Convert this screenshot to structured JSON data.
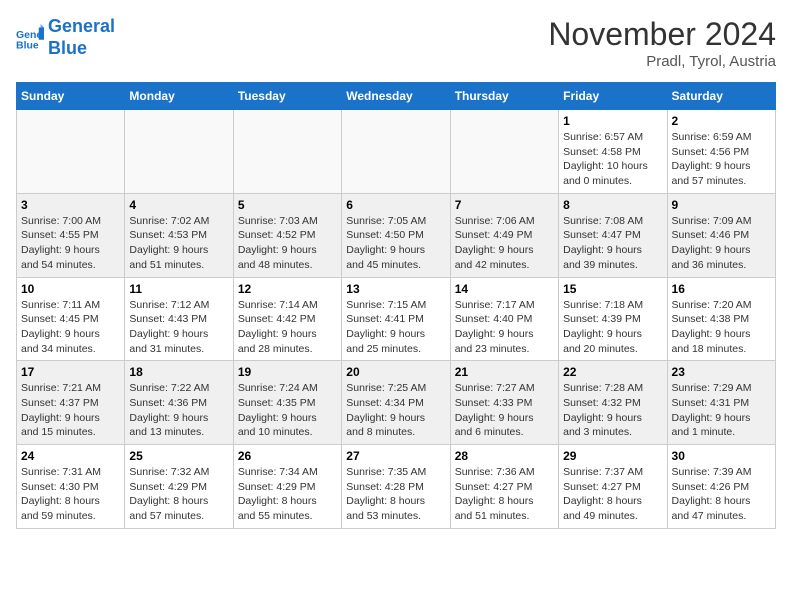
{
  "header": {
    "logo_line1": "General",
    "logo_line2": "Blue",
    "month": "November 2024",
    "location": "Pradl, Tyrol, Austria"
  },
  "weekdays": [
    "Sunday",
    "Monday",
    "Tuesday",
    "Wednesday",
    "Thursday",
    "Friday",
    "Saturday"
  ],
  "weeks": [
    [
      {
        "day": "",
        "info": ""
      },
      {
        "day": "",
        "info": ""
      },
      {
        "day": "",
        "info": ""
      },
      {
        "day": "",
        "info": ""
      },
      {
        "day": "",
        "info": ""
      },
      {
        "day": "1",
        "info": "Sunrise: 6:57 AM\nSunset: 4:58 PM\nDaylight: 10 hours\nand 0 minutes."
      },
      {
        "day": "2",
        "info": "Sunrise: 6:59 AM\nSunset: 4:56 PM\nDaylight: 9 hours\nand 57 minutes."
      }
    ],
    [
      {
        "day": "3",
        "info": "Sunrise: 7:00 AM\nSunset: 4:55 PM\nDaylight: 9 hours\nand 54 minutes."
      },
      {
        "day": "4",
        "info": "Sunrise: 7:02 AM\nSunset: 4:53 PM\nDaylight: 9 hours\nand 51 minutes."
      },
      {
        "day": "5",
        "info": "Sunrise: 7:03 AM\nSunset: 4:52 PM\nDaylight: 9 hours\nand 48 minutes."
      },
      {
        "day": "6",
        "info": "Sunrise: 7:05 AM\nSunset: 4:50 PM\nDaylight: 9 hours\nand 45 minutes."
      },
      {
        "day": "7",
        "info": "Sunrise: 7:06 AM\nSunset: 4:49 PM\nDaylight: 9 hours\nand 42 minutes."
      },
      {
        "day": "8",
        "info": "Sunrise: 7:08 AM\nSunset: 4:47 PM\nDaylight: 9 hours\nand 39 minutes."
      },
      {
        "day": "9",
        "info": "Sunrise: 7:09 AM\nSunset: 4:46 PM\nDaylight: 9 hours\nand 36 minutes."
      }
    ],
    [
      {
        "day": "10",
        "info": "Sunrise: 7:11 AM\nSunset: 4:45 PM\nDaylight: 9 hours\nand 34 minutes."
      },
      {
        "day": "11",
        "info": "Sunrise: 7:12 AM\nSunset: 4:43 PM\nDaylight: 9 hours\nand 31 minutes."
      },
      {
        "day": "12",
        "info": "Sunrise: 7:14 AM\nSunset: 4:42 PM\nDaylight: 9 hours\nand 28 minutes."
      },
      {
        "day": "13",
        "info": "Sunrise: 7:15 AM\nSunset: 4:41 PM\nDaylight: 9 hours\nand 25 minutes."
      },
      {
        "day": "14",
        "info": "Sunrise: 7:17 AM\nSunset: 4:40 PM\nDaylight: 9 hours\nand 23 minutes."
      },
      {
        "day": "15",
        "info": "Sunrise: 7:18 AM\nSunset: 4:39 PM\nDaylight: 9 hours\nand 20 minutes."
      },
      {
        "day": "16",
        "info": "Sunrise: 7:20 AM\nSunset: 4:38 PM\nDaylight: 9 hours\nand 18 minutes."
      }
    ],
    [
      {
        "day": "17",
        "info": "Sunrise: 7:21 AM\nSunset: 4:37 PM\nDaylight: 9 hours\nand 15 minutes."
      },
      {
        "day": "18",
        "info": "Sunrise: 7:22 AM\nSunset: 4:36 PM\nDaylight: 9 hours\nand 13 minutes."
      },
      {
        "day": "19",
        "info": "Sunrise: 7:24 AM\nSunset: 4:35 PM\nDaylight: 9 hours\nand 10 minutes."
      },
      {
        "day": "20",
        "info": "Sunrise: 7:25 AM\nSunset: 4:34 PM\nDaylight: 9 hours\nand 8 minutes."
      },
      {
        "day": "21",
        "info": "Sunrise: 7:27 AM\nSunset: 4:33 PM\nDaylight: 9 hours\nand 6 minutes."
      },
      {
        "day": "22",
        "info": "Sunrise: 7:28 AM\nSunset: 4:32 PM\nDaylight: 9 hours\nand 3 minutes."
      },
      {
        "day": "23",
        "info": "Sunrise: 7:29 AM\nSunset: 4:31 PM\nDaylight: 9 hours\nand 1 minute."
      }
    ],
    [
      {
        "day": "24",
        "info": "Sunrise: 7:31 AM\nSunset: 4:30 PM\nDaylight: 8 hours\nand 59 minutes."
      },
      {
        "day": "25",
        "info": "Sunrise: 7:32 AM\nSunset: 4:29 PM\nDaylight: 8 hours\nand 57 minutes."
      },
      {
        "day": "26",
        "info": "Sunrise: 7:34 AM\nSunset: 4:29 PM\nDaylight: 8 hours\nand 55 minutes."
      },
      {
        "day": "27",
        "info": "Sunrise: 7:35 AM\nSunset: 4:28 PM\nDaylight: 8 hours\nand 53 minutes."
      },
      {
        "day": "28",
        "info": "Sunrise: 7:36 AM\nSunset: 4:27 PM\nDaylight: 8 hours\nand 51 minutes."
      },
      {
        "day": "29",
        "info": "Sunrise: 7:37 AM\nSunset: 4:27 PM\nDaylight: 8 hours\nand 49 minutes."
      },
      {
        "day": "30",
        "info": "Sunrise: 7:39 AM\nSunset: 4:26 PM\nDaylight: 8 hours\nand 47 minutes."
      }
    ]
  ]
}
